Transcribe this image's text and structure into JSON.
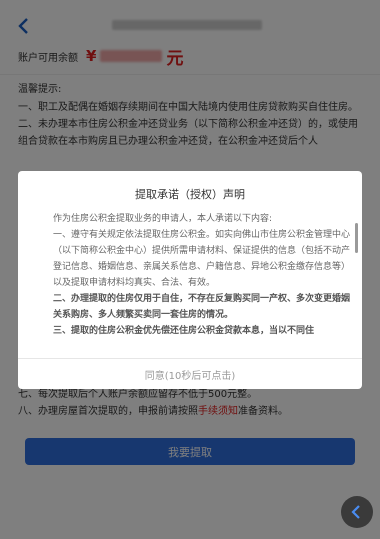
{
  "header": {
    "back_icon": "chevron-left-icon"
  },
  "balance": {
    "label": "账户可用余额",
    "currency_symbol": "¥",
    "unit": "元"
  },
  "tips": {
    "heading": "温馨提示:",
    "item1": "一、职工及配偶在婚姻存续期间在中国大陆境内使用住房贷款购买自住住房。",
    "item2": "二、未办理本市住房公积金冲还贷业务（以下简称公积金冲还贷）的，或使用组合贷款在本市购房且已办理公积金冲还贷，在公积金冲还贷后个人",
    "item7": "七、每次提取后个人账户余额应留存不低于500元整。",
    "item8_prefix": "八、办理房屋首次提取的，申报前请按照",
    "item8_link": "手续须知",
    "item8_suffix": "准备资料。"
  },
  "submit_button": "我要提取",
  "modal": {
    "title": "提取承诺（授权）声明",
    "intro": "作为住房公积金提取业务的申请人，本人承诺以下内容:",
    "p1": "一、遵守有关规定依法提取住房公积金。如实向佛山市住房公积金管理中心（以下简称公积金中心）提供所需申请材料、保证提供的信息（包括不动产登记信息、婚姻信息、亲属关系信息、户籍信息、异地公积金缴存信息等）以及提取申请材料均真实、合法、有效。",
    "p2": "二、办理提取的住房仅用于自住，不存在反复购买同一产权、多次变更婚姻关系购房、多人频繁买卖同一套住房的情况。",
    "p3": "三、提取的住房公积金优先偿还住房公积金贷款本息，当以不同住",
    "agree_button": "同意(10秒后可点击)"
  },
  "float_button_icon": "chevron-left-icon"
}
